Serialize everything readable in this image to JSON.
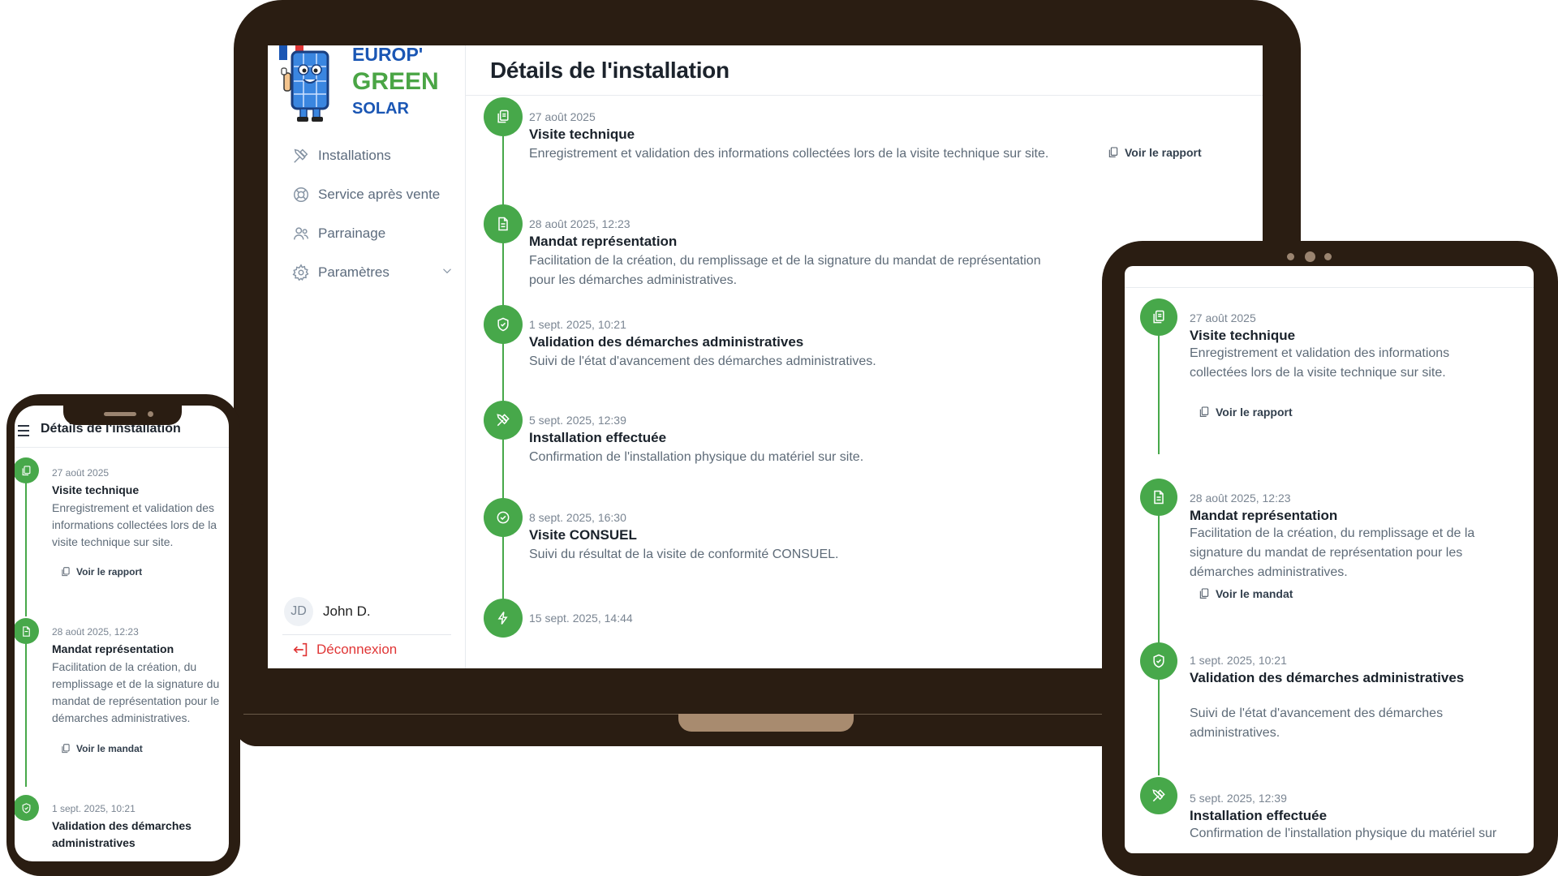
{
  "brand": {
    "line1": "EUROP'",
    "line2": "GREEN",
    "line3": "SOLAR",
    "colors": {
      "blue": "#1a56b4",
      "green": "#4aa545",
      "frame": "#2a1d12"
    }
  },
  "page": {
    "title": "Détails de l'installation"
  },
  "sidebar": {
    "items": [
      {
        "label": "Installations",
        "icon": "tools-icon"
      },
      {
        "label": "Service après vente",
        "icon": "lifebuoy-icon"
      },
      {
        "label": "Parrainage",
        "icon": "users-icon"
      },
      {
        "label": "Paramètres",
        "icon": "gear-icon"
      }
    ],
    "user": {
      "initials": "JD",
      "name": "John D."
    },
    "logout": "Déconnexion"
  },
  "timeline": [
    {
      "date": "27 août 2025",
      "title": "Visite technique",
      "desc": "Enregistrement et validation des informations collectées lors de la visite technique sur site.",
      "link": "Voir le rapport",
      "icon": "clipboard-icon"
    },
    {
      "date": "28 août 2025, 12:23",
      "title": "Mandat représentation",
      "desc": "Facilitation de la création, du remplissage et de la signature du mandat de représentation pour les démarches administratives.",
      "link": "Voir le mandat",
      "icon": "document-icon"
    },
    {
      "date": "1 sept. 2025, 10:21",
      "title": "Validation des démarches administratives",
      "desc": "Suivi de l'état d'avancement des démarches administratives.",
      "icon": "shield-check-icon"
    },
    {
      "date": "5 sept. 2025, 12:39",
      "title": "Installation effectuée",
      "desc": "Confirmation de l'installation physique du matériel sur site.",
      "icon": "tools-icon"
    },
    {
      "date": "8 sept. 2025, 16:30",
      "title": "Visite CONSUEL",
      "desc": "Suivi du résultat de la visite de conformité CONSUEL.",
      "icon": "check-circle-icon"
    },
    {
      "date": "15 sept. 2025, 14:44",
      "icon": "bolt-icon"
    }
  ],
  "laptop": {
    "desc1": "Enregistrement et validation des informations collectées lors de la visite technique sur site.",
    "desc2a": "Facilitation de la création, du remplissage et de la signature du mandat de représentation",
    "desc2b": "pour les démarches administratives."
  },
  "tablet": {
    "desc1a": "Enregistrement et validation des informations",
    "desc1b": "collectées lors de la visite technique sur site.",
    "desc2a": "Facilitation de la création, du remplissage et de la",
    "desc2b": "signature du mandat de représentation pour les",
    "desc2c": "démarches administratives.",
    "desc3a": "Suivi de l'état d'avancement des démarches",
    "desc3b": "administratives.",
    "desc4a": "Confirmation de l'installation physique du matériel sur"
  },
  "phone": {
    "desc1a": "Enregistrement et validation des",
    "desc1b": "informations collectées lors de la",
    "desc1c": "visite technique sur site.",
    "desc2a": "Facilitation de la création, du",
    "desc2b": "remplissage et de la signature du",
    "desc2c": "mandat de représentation pour le",
    "desc2d": "démarches administratives.",
    "title3a": "Validation des démarches",
    "title3b": "administratives"
  }
}
